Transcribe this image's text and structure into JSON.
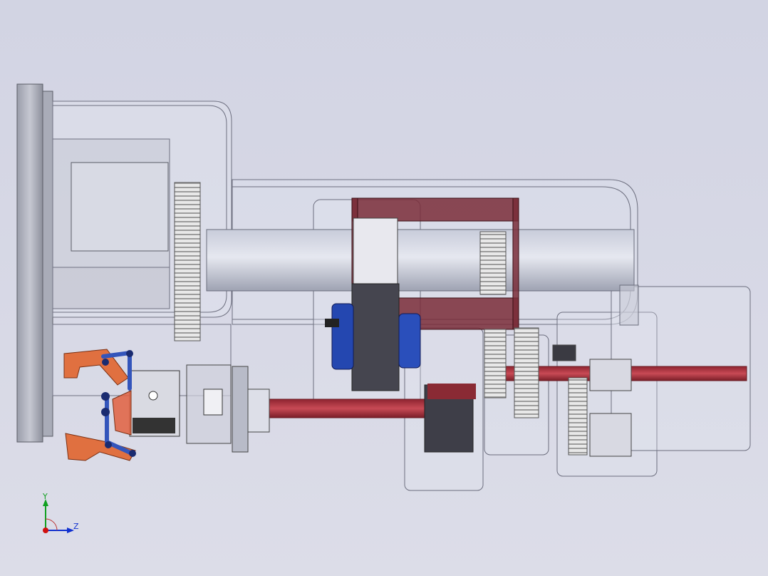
{
  "viewport": {
    "background_top": "#d2d4e3",
    "background_bottom": "#dcdde8"
  },
  "model": {
    "colors": {
      "housing_edge": "#7a7a8a",
      "shaft": "#b8bccb",
      "red_bracket": "#7a2d38",
      "red_rod": "#b0303a",
      "gear": "#e4e4e4",
      "blue_part": "#2244aa",
      "dark_block": "#4a4a55",
      "orange_linkage": "#e07040",
      "blue_linkage": "#3355bb"
    }
  },
  "triad": {
    "y_label": "Y",
    "z_label": "Z",
    "y_color": "#10a020",
    "z_color": "#1030d0",
    "x_color": "#d01010"
  }
}
